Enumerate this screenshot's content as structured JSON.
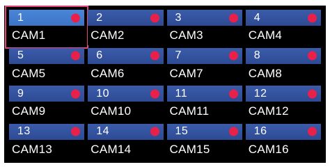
{
  "selected_index": 0,
  "colors": {
    "panel_bg": "#000000",
    "tile_header": "#2e4a94",
    "tile_header_selected": "#3c74c8",
    "status_dot": "#e8204a",
    "selection_border": "#e0457b",
    "text": "#ffffff"
  },
  "cameras": [
    {
      "number": "1",
      "name": "CAM1"
    },
    {
      "number": "2",
      "name": "CAM2"
    },
    {
      "number": "3",
      "name": "CAM3"
    },
    {
      "number": "4",
      "name": "CAM4"
    },
    {
      "number": "5",
      "name": "CAM5"
    },
    {
      "number": "6",
      "name": "CAM6"
    },
    {
      "number": "7",
      "name": "CAM7"
    },
    {
      "number": "8",
      "name": "CAM8"
    },
    {
      "number": "9",
      "name": "CAM9"
    },
    {
      "number": "10",
      "name": "CAM10"
    },
    {
      "number": "11",
      "name": "CAM11"
    },
    {
      "number": "12",
      "name": "CAM12"
    },
    {
      "number": "13",
      "name": "CAM13"
    },
    {
      "number": "14",
      "name": "CAM14"
    },
    {
      "number": "15",
      "name": "CAM15"
    },
    {
      "number": "16",
      "name": "CAM16"
    }
  ]
}
